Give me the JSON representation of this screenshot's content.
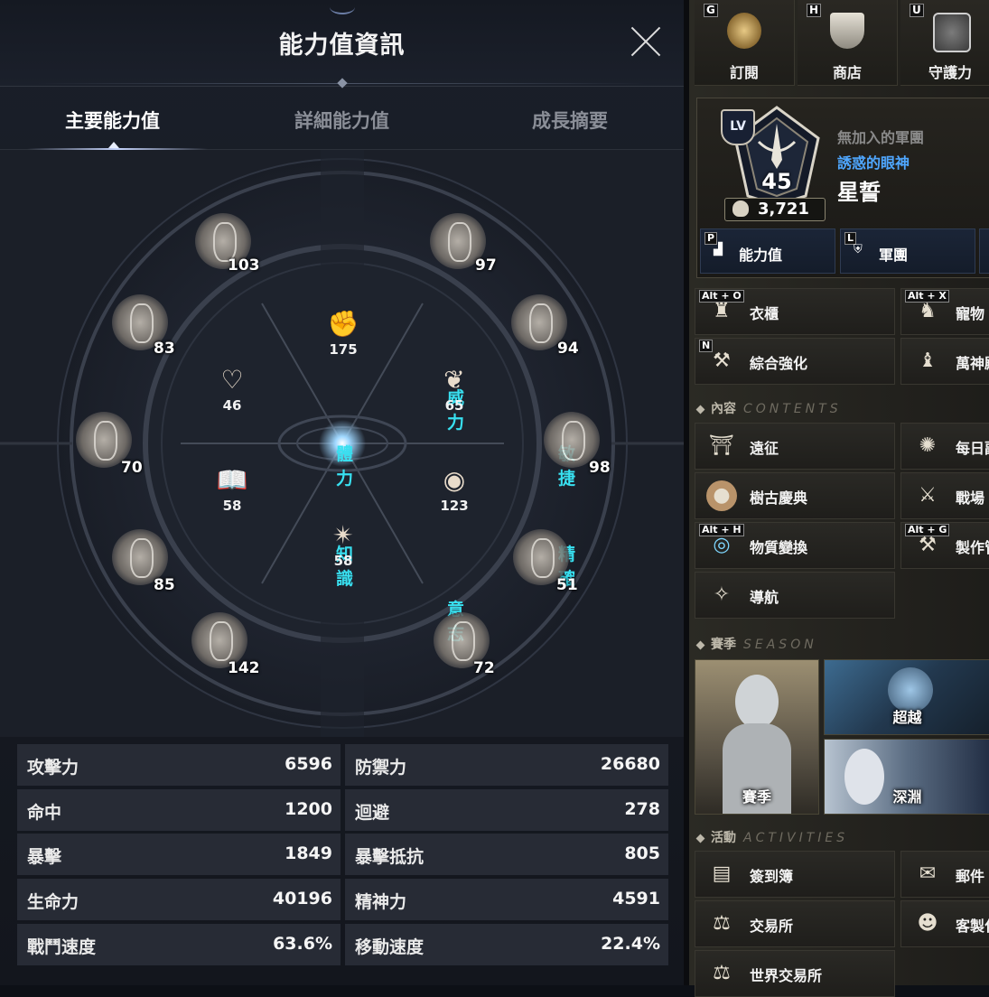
{
  "left": {
    "title": "能力值資訊",
    "tabs": [
      "主要能力值",
      "詳細能力值",
      "成長摘要"
    ],
    "core_stats": [
      {
        "name": "威力",
        "value": "175"
      },
      {
        "name": "體力",
        "value": "46"
      },
      {
        "name": "敏捷",
        "value": "65"
      },
      {
        "name": "知識",
        "value": "58"
      },
      {
        "name": "精確",
        "value": "123"
      },
      {
        "name": "意志",
        "value": "58"
      }
    ],
    "emblems": [
      "103",
      "97",
      "83",
      "94",
      "70",
      "98",
      "85",
      "51",
      "142",
      "72"
    ],
    "table": [
      {
        "k": "攻擊力",
        "v": "6596"
      },
      {
        "k": "防禦力",
        "v": "26680"
      },
      {
        "k": "命中",
        "v": "1200"
      },
      {
        "k": "迴避",
        "v": "278"
      },
      {
        "k": "暴擊",
        "v": "1849"
      },
      {
        "k": "暴擊抵抗",
        "v": "805"
      },
      {
        "k": "生命力",
        "v": "40196"
      },
      {
        "k": "精神力",
        "v": "4591"
      },
      {
        "k": "戰鬥速度",
        "v": "63.6%"
      },
      {
        "k": "移動速度",
        "v": "22.4%"
      }
    ]
  },
  "right": {
    "top_buttons": [
      {
        "hotkey": "G",
        "label": "訂閱",
        "icon": "m-coin-icon"
      },
      {
        "hotkey": "H",
        "label": "商店",
        "icon": "shop-shield-icon"
      },
      {
        "hotkey": "U",
        "label": "守護力",
        "icon": "guardian-rune-icon"
      }
    ],
    "profile": {
      "lv_badge": "LV",
      "level": "45",
      "power": "3,721",
      "guild": "無加入的軍團",
      "title": "誘惑的眼神",
      "name": "星誓",
      "buttons": [
        {
          "hotkey": "P",
          "label": "能力值",
          "icon": "bar-chart-icon"
        },
        {
          "hotkey": "L",
          "label": "軍團",
          "icon": "guild-banner-icon"
        }
      ]
    },
    "menu_top": [
      {
        "hotkey": "Alt + O",
        "label": "衣櫃",
        "icon": "wardrobe-icon"
      },
      {
        "hotkey": "Alt + X",
        "label": "寵物",
        "icon": "pet-icon"
      },
      {
        "hotkey": "N",
        "label": "綜合強化",
        "icon": "anvil-icon"
      },
      {
        "hotkey": "",
        "label": "萬神殿",
        "icon": "pantheon-statue-icon"
      }
    ],
    "section_content": {
      "label": "內容",
      "deco": "CONTENTS"
    },
    "menu_content": [
      {
        "hotkey": "",
        "label": "遠征",
        "icon": "portal-icon"
      },
      {
        "hotkey": "",
        "label": "每日副本",
        "icon": "swirl-icon"
      },
      {
        "hotkey": "",
        "label": "樹古慶典",
        "icon": "hamster-icon"
      },
      {
        "hotkey": "",
        "label": "戰場",
        "icon": "crossed-swords-icon"
      },
      {
        "hotkey": "Alt + H",
        "label": "物質變換",
        "icon": "orb-icon"
      },
      {
        "hotkey": "Alt + G",
        "label": "製作管理",
        "icon": "hammer-icon"
      },
      {
        "hotkey": "",
        "label": "導航",
        "icon": "compass-icon"
      }
    ],
    "section_season": {
      "label": "賽季",
      "deco": "SEASON"
    },
    "season_cards": [
      {
        "label": "賽季"
      },
      {
        "label": "超越"
      },
      {
        "label": "深淵"
      }
    ],
    "section_activity": {
      "label": "活動",
      "deco": "ACTIVITIES"
    },
    "menu_activity": [
      {
        "hotkey": "",
        "label": "簽到簿",
        "icon": "calendar-book-icon"
      },
      {
        "hotkey": "",
        "label": "郵件",
        "icon": "mail-icon"
      },
      {
        "hotkey": "",
        "label": "交易所",
        "icon": "scales-icon"
      },
      {
        "hotkey": "",
        "label": "客製化",
        "icon": "bust-icon"
      },
      {
        "hotkey": "",
        "label": "世界交易所",
        "icon": "globe-scales-icon"
      }
    ]
  }
}
